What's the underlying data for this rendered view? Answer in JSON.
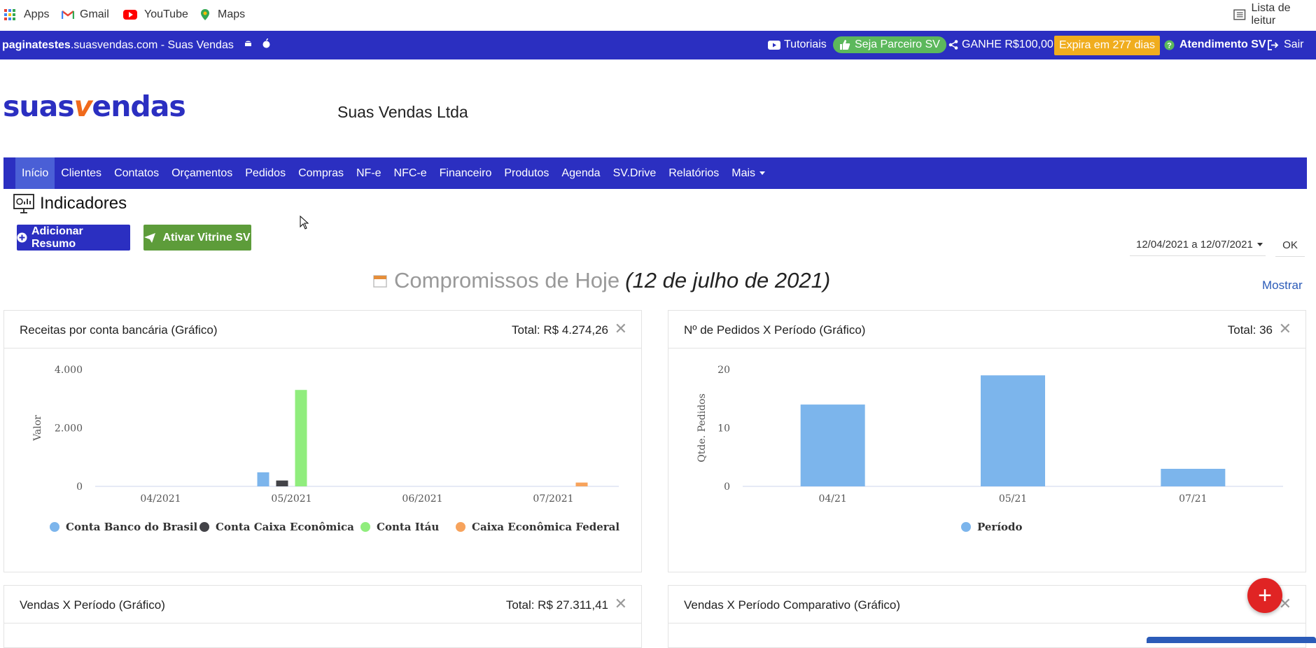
{
  "bookmarks": {
    "apps": "Apps",
    "gmail": "Gmail",
    "youtube": "YouTube",
    "maps": "Maps",
    "reading_list": "Lista de leitur"
  },
  "topbar": {
    "domain_bold": "paginatestes",
    "domain_rest": ".suasvendas.com - Suas Vendas",
    "tutoriais": "Tutoriais",
    "parceiro": "Seja Parceiro SV",
    "ganhe": "GANHE R$100,00",
    "expira": "Expira em 277 dias",
    "atendimento": "Atendimento SV",
    "sair": "Sair"
  },
  "header": {
    "logo_a": "suas",
    "logo_v": "v",
    "logo_b": "endas",
    "company": "Suas Vendas Ltda"
  },
  "nav": [
    "Início",
    "Clientes",
    "Contatos",
    "Orçamentos",
    "Pedidos",
    "Compras",
    "NF-e",
    "NFC-e",
    "Financeiro",
    "Produtos",
    "Agenda",
    "SV.Drive",
    "Relatórios",
    "Mais"
  ],
  "indicators": {
    "title": "Indicadores",
    "add_resumo": "Adicionar Resumo",
    "ativar_vitrine": "Ativar Vitrine SV",
    "date_range": "12/04/2021 a 12/07/2021",
    "ok": "OK",
    "compromissos": "Compromissos de Hoje",
    "compromissos_date": "(12 de julho de 2021)",
    "mostrar": "Mostrar"
  },
  "panels": {
    "receitas": {
      "title": "Receitas por conta bancária (Gráfico)",
      "total": "Total: R$ 4.274,26"
    },
    "pedidos": {
      "title": "Nº de Pedidos X Período (Gráfico)",
      "total": "Total: 36"
    },
    "vendas": {
      "title": "Vendas X Período (Gráfico)",
      "total": "Total: R$ 27.311,41"
    },
    "vendas_comp": {
      "title": "Vendas X Período Comparativo (Gráfico)"
    }
  },
  "colors": {
    "brand_blue": "#2b2fc1",
    "accent_orange": "#f0ad1e",
    "green": "#5cb85c",
    "fab_red": "#e02424"
  },
  "chart_data": [
    {
      "type": "bar",
      "categories": [
        "04/2021",
        "05/2021",
        "06/2021",
        "07/2021"
      ],
      "ylabel": "Valor",
      "ylim": [
        0,
        4000
      ],
      "yticks": [
        "4.000",
        "2.000",
        "0"
      ],
      "legend_position": "bottom",
      "series": [
        {
          "name": "Conta Banco do Brasil",
          "color": "#7cb5ec",
          "values": [
            0,
            480,
            0,
            0
          ]
        },
        {
          "name": "Conta Caixa Econômica",
          "color": "#434348",
          "values": [
            0,
            200,
            0,
            0
          ]
        },
        {
          "name": "Conta Itáu",
          "color": "#90ed7d",
          "values": [
            0,
            3300,
            0,
            0
          ]
        },
        {
          "name": "Caixa Econômica Federal",
          "color": "#f7a35c",
          "values": [
            0,
            0,
            0,
            130
          ]
        }
      ]
    },
    {
      "type": "bar",
      "categories": [
        "04/21",
        "05/21",
        "07/21"
      ],
      "ylabel": "Qtde. Pedidos",
      "ylim": [
        0,
        20
      ],
      "yticks": [
        "20",
        "10",
        "0"
      ],
      "legend_position": "bottom",
      "series": [
        {
          "name": "Período",
          "color": "#7cb5ec",
          "values": [
            14,
            19,
            3
          ]
        }
      ]
    }
  ]
}
